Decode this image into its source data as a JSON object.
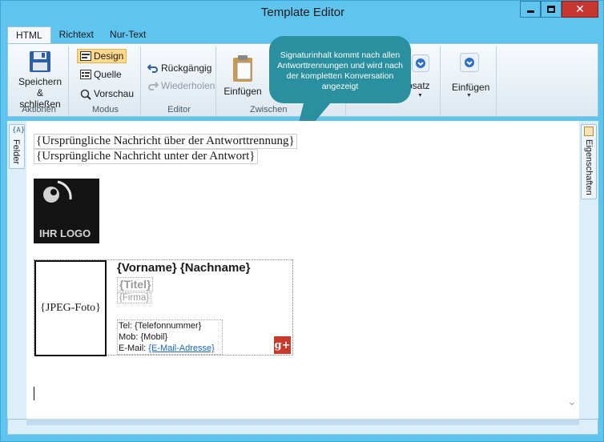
{
  "window": {
    "title": "Template Editor",
    "close_glyph": "✕"
  },
  "tabs": [
    {
      "label": "HTML",
      "active": true
    },
    {
      "label": "Richtext",
      "active": false
    },
    {
      "label": "Nur-Text",
      "active": false
    }
  ],
  "ribbon": {
    "aktionen": {
      "label": "Aktionen",
      "save_line1": "Speichern &",
      "save_line2": "schließen"
    },
    "modus": {
      "label": "Modus",
      "design": "Design",
      "quelle": "Quelle",
      "vorschau": "Vorschau"
    },
    "editor": {
      "label": "Editor",
      "undo": "Rückgängig",
      "redo": "Wiederholen"
    },
    "clipboard": {
      "label_visible": "Zwischen",
      "paste": "Einfügen"
    },
    "absatz": {
      "label_visible": "bsatz"
    },
    "insert": {
      "label": "Einfügen"
    }
  },
  "tooltip": {
    "text": "Signaturinhalt kommt nach allen Antworttrennungen und wird nach der kompletten Konversation angezeigt"
  },
  "side": {
    "left_tab": "Felder",
    "right_tab": "Eigenschaften"
  },
  "content": {
    "marker_above": "{Ursprüngliche Nachricht über der Antworttrennung}",
    "marker_below": "{Ursprüngliche Nachricht unter der Antwort}",
    "logo_text": "IHR LOGO",
    "photo": "{JPEG-Foto}",
    "name": "{Vorname} {Nachname}",
    "titel": "{Titel}",
    "firma": "{Firma}",
    "tel": "Tel: {Telefonnummer}",
    "mob": "Mob: {Mobil}",
    "email_label": "E-Mail: ",
    "email_value": "{E-Mail-Adresse}",
    "gplus": "g+"
  },
  "colors": {
    "accent": "#5fc4ee",
    "bubble": "#2a8f9f",
    "close": "#c7372f",
    "selected": "#ffd98a"
  }
}
